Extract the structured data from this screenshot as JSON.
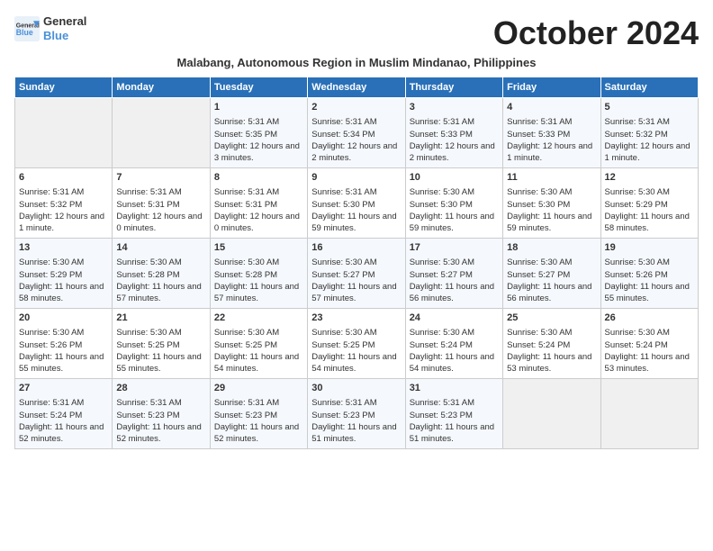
{
  "logo": {
    "line1": "General",
    "line2": "Blue"
  },
  "title": "October 2024",
  "subtitle": "Malabang, Autonomous Region in Muslim Mindanao, Philippines",
  "weekdays": [
    "Sunday",
    "Monday",
    "Tuesday",
    "Wednesday",
    "Thursday",
    "Friday",
    "Saturday"
  ],
  "weeks": [
    [
      {
        "day": "",
        "sunrise": "",
        "sunset": "",
        "daylight": ""
      },
      {
        "day": "",
        "sunrise": "",
        "sunset": "",
        "daylight": ""
      },
      {
        "day": "1",
        "sunrise": "Sunrise: 5:31 AM",
        "sunset": "Sunset: 5:35 PM",
        "daylight": "Daylight: 12 hours and 3 minutes."
      },
      {
        "day": "2",
        "sunrise": "Sunrise: 5:31 AM",
        "sunset": "Sunset: 5:34 PM",
        "daylight": "Daylight: 12 hours and 2 minutes."
      },
      {
        "day": "3",
        "sunrise": "Sunrise: 5:31 AM",
        "sunset": "Sunset: 5:33 PM",
        "daylight": "Daylight: 12 hours and 2 minutes."
      },
      {
        "day": "4",
        "sunrise": "Sunrise: 5:31 AM",
        "sunset": "Sunset: 5:33 PM",
        "daylight": "Daylight: 12 hours and 1 minute."
      },
      {
        "day": "5",
        "sunrise": "Sunrise: 5:31 AM",
        "sunset": "Sunset: 5:32 PM",
        "daylight": "Daylight: 12 hours and 1 minute."
      }
    ],
    [
      {
        "day": "6",
        "sunrise": "Sunrise: 5:31 AM",
        "sunset": "Sunset: 5:32 PM",
        "daylight": "Daylight: 12 hours and 1 minute."
      },
      {
        "day": "7",
        "sunrise": "Sunrise: 5:31 AM",
        "sunset": "Sunset: 5:31 PM",
        "daylight": "Daylight: 12 hours and 0 minutes."
      },
      {
        "day": "8",
        "sunrise": "Sunrise: 5:31 AM",
        "sunset": "Sunset: 5:31 PM",
        "daylight": "Daylight: 12 hours and 0 minutes."
      },
      {
        "day": "9",
        "sunrise": "Sunrise: 5:31 AM",
        "sunset": "Sunset: 5:30 PM",
        "daylight": "Daylight: 11 hours and 59 minutes."
      },
      {
        "day": "10",
        "sunrise": "Sunrise: 5:30 AM",
        "sunset": "Sunset: 5:30 PM",
        "daylight": "Daylight: 11 hours and 59 minutes."
      },
      {
        "day": "11",
        "sunrise": "Sunrise: 5:30 AM",
        "sunset": "Sunset: 5:30 PM",
        "daylight": "Daylight: 11 hours and 59 minutes."
      },
      {
        "day": "12",
        "sunrise": "Sunrise: 5:30 AM",
        "sunset": "Sunset: 5:29 PM",
        "daylight": "Daylight: 11 hours and 58 minutes."
      }
    ],
    [
      {
        "day": "13",
        "sunrise": "Sunrise: 5:30 AM",
        "sunset": "Sunset: 5:29 PM",
        "daylight": "Daylight: 11 hours and 58 minutes."
      },
      {
        "day": "14",
        "sunrise": "Sunrise: 5:30 AM",
        "sunset": "Sunset: 5:28 PM",
        "daylight": "Daylight: 11 hours and 57 minutes."
      },
      {
        "day": "15",
        "sunrise": "Sunrise: 5:30 AM",
        "sunset": "Sunset: 5:28 PM",
        "daylight": "Daylight: 11 hours and 57 minutes."
      },
      {
        "day": "16",
        "sunrise": "Sunrise: 5:30 AM",
        "sunset": "Sunset: 5:27 PM",
        "daylight": "Daylight: 11 hours and 57 minutes."
      },
      {
        "day": "17",
        "sunrise": "Sunrise: 5:30 AM",
        "sunset": "Sunset: 5:27 PM",
        "daylight": "Daylight: 11 hours and 56 minutes."
      },
      {
        "day": "18",
        "sunrise": "Sunrise: 5:30 AM",
        "sunset": "Sunset: 5:27 PM",
        "daylight": "Daylight: 11 hours and 56 minutes."
      },
      {
        "day": "19",
        "sunrise": "Sunrise: 5:30 AM",
        "sunset": "Sunset: 5:26 PM",
        "daylight": "Daylight: 11 hours and 55 minutes."
      }
    ],
    [
      {
        "day": "20",
        "sunrise": "Sunrise: 5:30 AM",
        "sunset": "Sunset: 5:26 PM",
        "daylight": "Daylight: 11 hours and 55 minutes."
      },
      {
        "day": "21",
        "sunrise": "Sunrise: 5:30 AM",
        "sunset": "Sunset: 5:25 PM",
        "daylight": "Daylight: 11 hours and 55 minutes."
      },
      {
        "day": "22",
        "sunrise": "Sunrise: 5:30 AM",
        "sunset": "Sunset: 5:25 PM",
        "daylight": "Daylight: 11 hours and 54 minutes."
      },
      {
        "day": "23",
        "sunrise": "Sunrise: 5:30 AM",
        "sunset": "Sunset: 5:25 PM",
        "daylight": "Daylight: 11 hours and 54 minutes."
      },
      {
        "day": "24",
        "sunrise": "Sunrise: 5:30 AM",
        "sunset": "Sunset: 5:24 PM",
        "daylight": "Daylight: 11 hours and 54 minutes."
      },
      {
        "day": "25",
        "sunrise": "Sunrise: 5:30 AM",
        "sunset": "Sunset: 5:24 PM",
        "daylight": "Daylight: 11 hours and 53 minutes."
      },
      {
        "day": "26",
        "sunrise": "Sunrise: 5:30 AM",
        "sunset": "Sunset: 5:24 PM",
        "daylight": "Daylight: 11 hours and 53 minutes."
      }
    ],
    [
      {
        "day": "27",
        "sunrise": "Sunrise: 5:31 AM",
        "sunset": "Sunset: 5:24 PM",
        "daylight": "Daylight: 11 hours and 52 minutes."
      },
      {
        "day": "28",
        "sunrise": "Sunrise: 5:31 AM",
        "sunset": "Sunset: 5:23 PM",
        "daylight": "Daylight: 11 hours and 52 minutes."
      },
      {
        "day": "29",
        "sunrise": "Sunrise: 5:31 AM",
        "sunset": "Sunset: 5:23 PM",
        "daylight": "Daylight: 11 hours and 52 minutes."
      },
      {
        "day": "30",
        "sunrise": "Sunrise: 5:31 AM",
        "sunset": "Sunset: 5:23 PM",
        "daylight": "Daylight: 11 hours and 51 minutes."
      },
      {
        "day": "31",
        "sunrise": "Sunrise: 5:31 AM",
        "sunset": "Sunset: 5:23 PM",
        "daylight": "Daylight: 11 hours and 51 minutes."
      },
      {
        "day": "",
        "sunrise": "",
        "sunset": "",
        "daylight": ""
      },
      {
        "day": "",
        "sunrise": "",
        "sunset": "",
        "daylight": ""
      }
    ]
  ]
}
